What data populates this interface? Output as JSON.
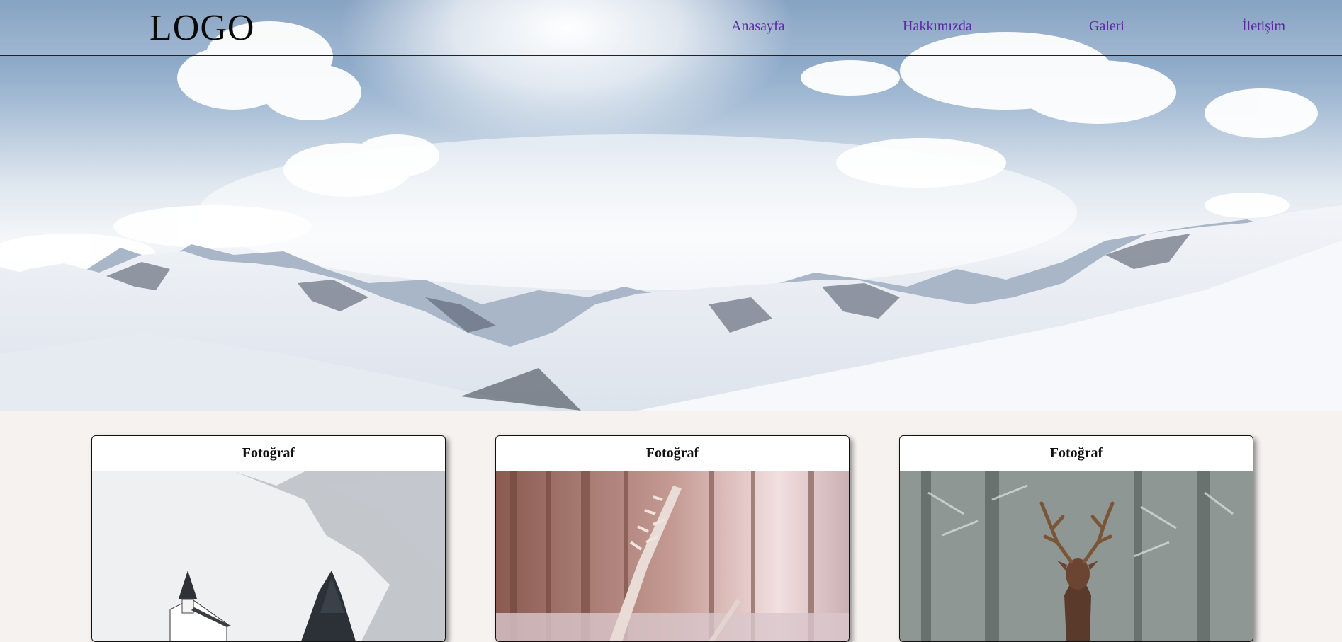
{
  "header": {
    "logo": "LOGO",
    "nav": [
      "Anasayfa",
      "Hakkımızda",
      "Galeri",
      "İletişim"
    ]
  },
  "hero": {
    "icon": "mountain-landscape-image"
  },
  "cards": [
    {
      "title": "Fotoğraf",
      "image": "snowy-chapel-image"
    },
    {
      "title": "Fotoğraf",
      "image": "frosted-grass-image"
    },
    {
      "title": "Fotoğraf",
      "image": "deer-in-snow-image"
    }
  ]
}
